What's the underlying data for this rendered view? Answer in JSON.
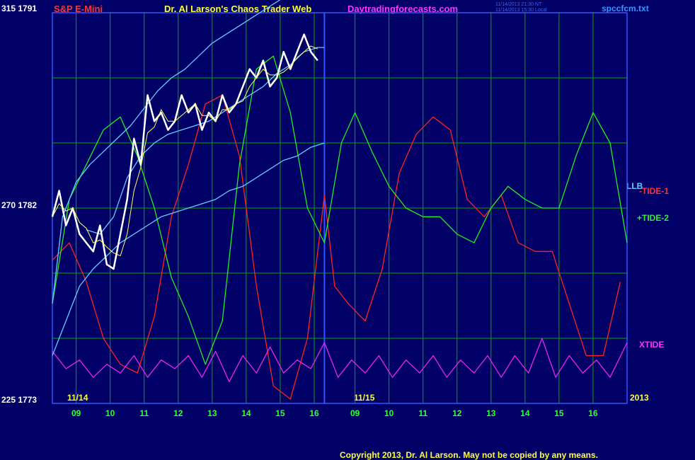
{
  "header": {
    "ylab_top": "315  1791",
    "instrument": "S&P E-Mini",
    "title": "Dr. Al Larson's Chaos Trader Web",
    "site": "Daytradingforecasts.com",
    "timestamp1": "11/14/2013 21:30 NT",
    "timestamp2": "11/14/2013 15:30 Local",
    "filename": "spccfcm.txt"
  },
  "left_labels": {
    "mid": "270  1782",
    "bottom": "225  1773"
  },
  "date_labels": {
    "d1": "11/14",
    "d2": "11/15",
    "year": "2013"
  },
  "legend": {
    "llb": "LLB",
    "tide1": "-TIDE-1",
    "tide2": "+TIDE-2",
    "xtide": "XTIDE"
  },
  "copyright": "Copyright 2013, Dr. Al Larson. May not be copied by any means.",
  "colors": {
    "background": "#000066",
    "grid": "#00aa00",
    "price": "#ffffff",
    "ma": "#ffff66",
    "llb": "#66ccff",
    "tide1": "#ff2222",
    "tide2": "#22ee22",
    "xtide": "#ee22ee",
    "divider": "#3355ff"
  },
  "chart_data": {
    "type": "line",
    "x_ticks": [
      "09",
      "10",
      "11",
      "12",
      "13",
      "14",
      "15",
      "16",
      "09",
      "10",
      "11",
      "12",
      "13",
      "14",
      "15",
      "16"
    ],
    "y_left_scale": {
      "top": 315,
      "mid": 270,
      "bottom": 225
    },
    "y_price_scale": {
      "top": 1791,
      "mid": 1782,
      "bottom": 1773
    },
    "x_range_hours": [
      8.3,
      25.2
    ],
    "divider_x": 16.3,
    "series": [
      {
        "name": "-TIDE-1",
        "x": [
          8.3,
          8.8,
          9.3,
          9.8,
          10.3,
          10.8,
          11.3,
          11.8,
          12.3,
          12.8,
          13.3,
          13.8,
          14.3,
          14.8,
          15.3,
          15.8,
          16.3,
          16.6,
          17.0,
          17.5,
          18.0,
          18.5,
          19.0,
          19.5,
          20.0,
          20.5,
          21.0,
          21.5,
          22.0,
          22.5,
          23.0,
          23.5,
          24.0,
          24.5,
          25.0
        ],
        "y": [
          258,
          262,
          253,
          240,
          234,
          232,
          245,
          268,
          280,
          294,
          296,
          282,
          252,
          229,
          226,
          240,
          273,
          252,
          248,
          244,
          256,
          278,
          287,
          291,
          288,
          272,
          268,
          273,
          262,
          260,
          260,
          248,
          236,
          236,
          253
        ]
      },
      {
        "name": "+TIDE-2",
        "x": [
          8.3,
          8.8,
          9.3,
          9.8,
          10.3,
          10.8,
          11.3,
          11.8,
          12.3,
          12.8,
          13.3,
          13.8,
          14.3,
          14.8,
          15.3,
          15.8,
          16.3,
          16.8,
          17.2,
          17.7,
          18.2,
          18.7,
          19.2,
          19.7,
          20.2,
          20.7,
          21.2,
          21.7,
          22.2,
          22.7,
          23.2,
          23.7,
          24.2,
          24.7,
          25.2
        ],
        "y": [
          248,
          272,
          280,
          288,
          291,
          282,
          270,
          254,
          245,
          234,
          244,
          280,
          302,
          305,
          292,
          270,
          262,
          285,
          292,
          283,
          275,
          270,
          268,
          268,
          264,
          262,
          270,
          275,
          272,
          270,
          270,
          282,
          292,
          285,
          262
        ]
      },
      {
        "name": "XTIDE",
        "x": [
          8.3,
          8.7,
          9.1,
          9.5,
          9.9,
          10.3,
          10.7,
          11.1,
          11.5,
          11.9,
          12.3,
          12.7,
          13.1,
          13.5,
          13.9,
          14.3,
          14.7,
          15.1,
          15.5,
          15.9,
          16.3,
          16.7,
          17.1,
          17.5,
          17.9,
          18.3,
          18.7,
          19.1,
          19.5,
          19.9,
          20.3,
          20.7,
          21.1,
          21.5,
          21.9,
          22.3,
          22.7,
          23.1,
          23.5,
          23.9,
          24.3,
          24.7,
          25.2
        ],
        "y": [
          237,
          233,
          235,
          231,
          234,
          232,
          236,
          231,
          235,
          233,
          236,
          231,
          237,
          230,
          236,
          232,
          238,
          232,
          235,
          233,
          239,
          231,
          235,
          232,
          236,
          231,
          235,
          232,
          236,
          231,
          235,
          232,
          236,
          231,
          236,
          232,
          240,
          231,
          236,
          232,
          235,
          231,
          239
        ]
      },
      {
        "name": "LLB-upper",
        "x": [
          8.3,
          8.6,
          9.0,
          9.4,
          9.8,
          10.2,
          10.6,
          11.0,
          11.4,
          11.8,
          12.2,
          12.6,
          13.0,
          13.4,
          13.8,
          14.2,
          14.6,
          15.0,
          15.2
        ],
        "y": [
          248,
          268,
          276,
          280,
          283,
          286,
          289,
          293,
          297,
          300,
          302,
          305,
          308,
          310,
          312,
          314,
          316,
          318,
          319
        ]
      },
      {
        "name": "LLB-lower",
        "x": [
          8.3,
          8.7,
          9.1,
          9.5,
          9.9,
          10.3,
          10.7,
          11.1,
          11.5,
          11.9,
          12.3,
          12.7,
          13.1,
          13.5,
          13.9,
          14.3,
          14.7,
          15.1,
          15.5,
          15.9,
          16.3
        ],
        "y": [
          236,
          244,
          252,
          256,
          259,
          262,
          264,
          266,
          268,
          269,
          270,
          271,
          272,
          274,
          275,
          277,
          279,
          281,
          282,
          284,
          285
        ]
      },
      {
        "name": "LLB-mid",
        "x": [
          9.3,
          9.7,
          10.1,
          10.5,
          10.9,
          11.3,
          11.7,
          12.1,
          12.5,
          12.9,
          13.3,
          13.7,
          14.1,
          14.5,
          14.9,
          15.3,
          15.7,
          16.1,
          16.3
        ],
        "y": [
          265,
          264,
          268,
          277,
          282,
          285,
          287,
          288,
          289,
          290,
          292,
          294,
          296,
          298,
          301,
          303,
          306,
          307,
          307
        ]
      },
      {
        "name": "price",
        "x": [
          8.3,
          8.5,
          8.7,
          8.9,
          9.1,
          9.3,
          9.5,
          9.7,
          9.9,
          10.1,
          10.3,
          10.5,
          10.7,
          10.9,
          11.1,
          11.3,
          11.5,
          11.7,
          11.9,
          12.1,
          12.3,
          12.5,
          12.7,
          12.9,
          13.1,
          13.3,
          13.5,
          13.7,
          13.9,
          14.1,
          14.3,
          14.5,
          14.7,
          14.9,
          15.1,
          15.3,
          15.5,
          15.7,
          15.9,
          16.1
        ],
        "y": [
          268,
          274,
          266,
          270,
          264,
          262,
          260,
          266,
          257,
          256,
          264,
          272,
          286,
          280,
          296,
          290,
          292,
          288,
          290,
          296,
          292,
          294,
          288,
          292,
          290,
          296,
          292,
          294,
          298,
          302,
          300,
          304,
          298,
          300,
          306,
          302,
          306,
          310,
          306,
          304
        ]
      }
    ]
  }
}
